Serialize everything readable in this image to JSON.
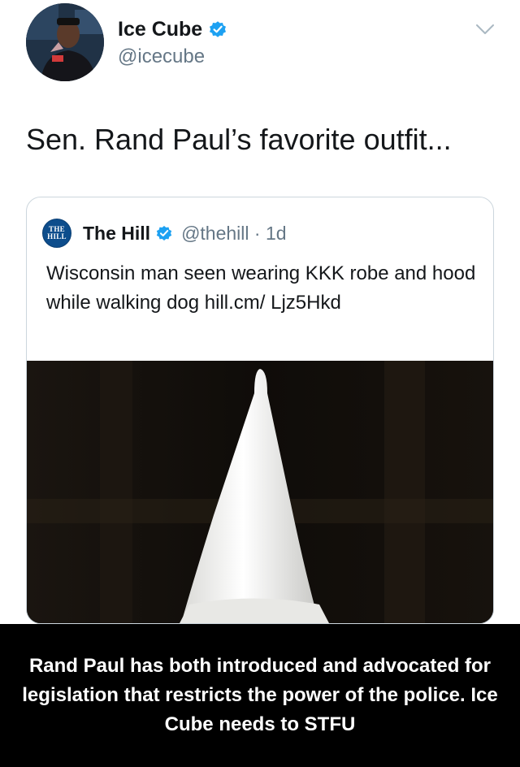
{
  "tweet": {
    "author_name": "Ice Cube",
    "author_handle": "@icecube",
    "text": "Sen. Rand Paul’s favorite outfit...",
    "verified": true
  },
  "quoted_tweet": {
    "logo_text_top": "THE",
    "logo_text_bottom": "HILL",
    "author_name": "The Hill",
    "author_handle": "@thehill · 1d",
    "text": "Wisconsin man seen wearing KKK robe and hood while walking dog hill.cm/ Ljz5Hkd",
    "verified": true
  },
  "caption": {
    "text": "Rand Paul has both introduced and advocated for legislation that restricts the power of the police. Ice Cube needs to STFU"
  },
  "colors": {
    "verified_badge": "#1da1f2",
    "secondary_text": "#657786",
    "caption_background": "#000000"
  },
  "icons": {
    "verified": "verified-badge-icon",
    "more": "chevron-down-icon"
  }
}
